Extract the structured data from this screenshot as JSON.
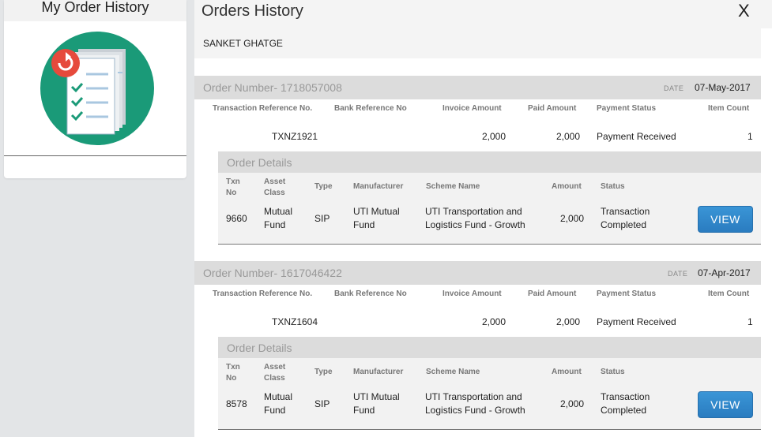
{
  "sidebar": {
    "title": "My Order History"
  },
  "modal": {
    "title": "Orders History",
    "close_label": "X",
    "customer_name": "SANKET GHATGE"
  },
  "order_columns": [
    "Transaction Reference No.",
    "Bank Reference No",
    "Invoice Amount",
    "Paid Amount",
    "Payment Status",
    "Item Count"
  ],
  "details_columns": {
    "txn_no": [
      "Txn",
      "No"
    ],
    "asset_class": [
      "Asset",
      "Class"
    ],
    "type": "Type",
    "manufacturer": "Manufacturer",
    "scheme_name": "Scheme Name",
    "amount": "Amount",
    "status": "Status"
  },
  "orders": [
    {
      "order_number": "Order Number- 1718057008",
      "date_label": "DATE",
      "date": "07-May-2017",
      "txn_ref": "TXNZ1921",
      "bank_ref": "",
      "invoice_amount": "2,000",
      "paid_amount": "2,000",
      "payment_status": "Payment Received",
      "item_count": "1",
      "details_title": "Order Details",
      "detail": {
        "txn_no": "9660",
        "asset_class": [
          "Mutual",
          "Fund"
        ],
        "type": "SIP",
        "manufacturer": [
          "UTI Mutual",
          "Fund"
        ],
        "scheme_name": [
          "UTI Transportation and",
          "Logistics Fund - Growth"
        ],
        "amount": "2,000",
        "status": [
          "Transaction",
          "Completed"
        ],
        "action": "VIEW"
      }
    },
    {
      "order_number": "Order Number- 1617046422",
      "date_label": "DATE",
      "date": "07-Apr-2017",
      "txn_ref": "TXNZ1604",
      "bank_ref": "",
      "invoice_amount": "2,000",
      "paid_amount": "2,000",
      "payment_status": "Payment Received",
      "item_count": "1",
      "details_title": "Order Details",
      "detail": {
        "txn_no": "8578",
        "asset_class": [
          "Mutual",
          "Fund"
        ],
        "type": "SIP",
        "manufacturer": [
          "UTI Mutual",
          "Fund"
        ],
        "scheme_name": [
          "UTI Transportation and",
          "Logistics Fund - Growth"
        ],
        "amount": "2,000",
        "status": [
          "Transaction",
          "Completed"
        ],
        "action": "VIEW"
      }
    }
  ],
  "icons": {
    "sidebar_illustration": "order-history-illustration",
    "refresh": "refresh-icon",
    "checklist": "checklist-icon"
  },
  "colors": {
    "illustration_bg": "#1a9a78",
    "refresh_badge": "#e64a3c",
    "view_button": "#3a95d6"
  }
}
